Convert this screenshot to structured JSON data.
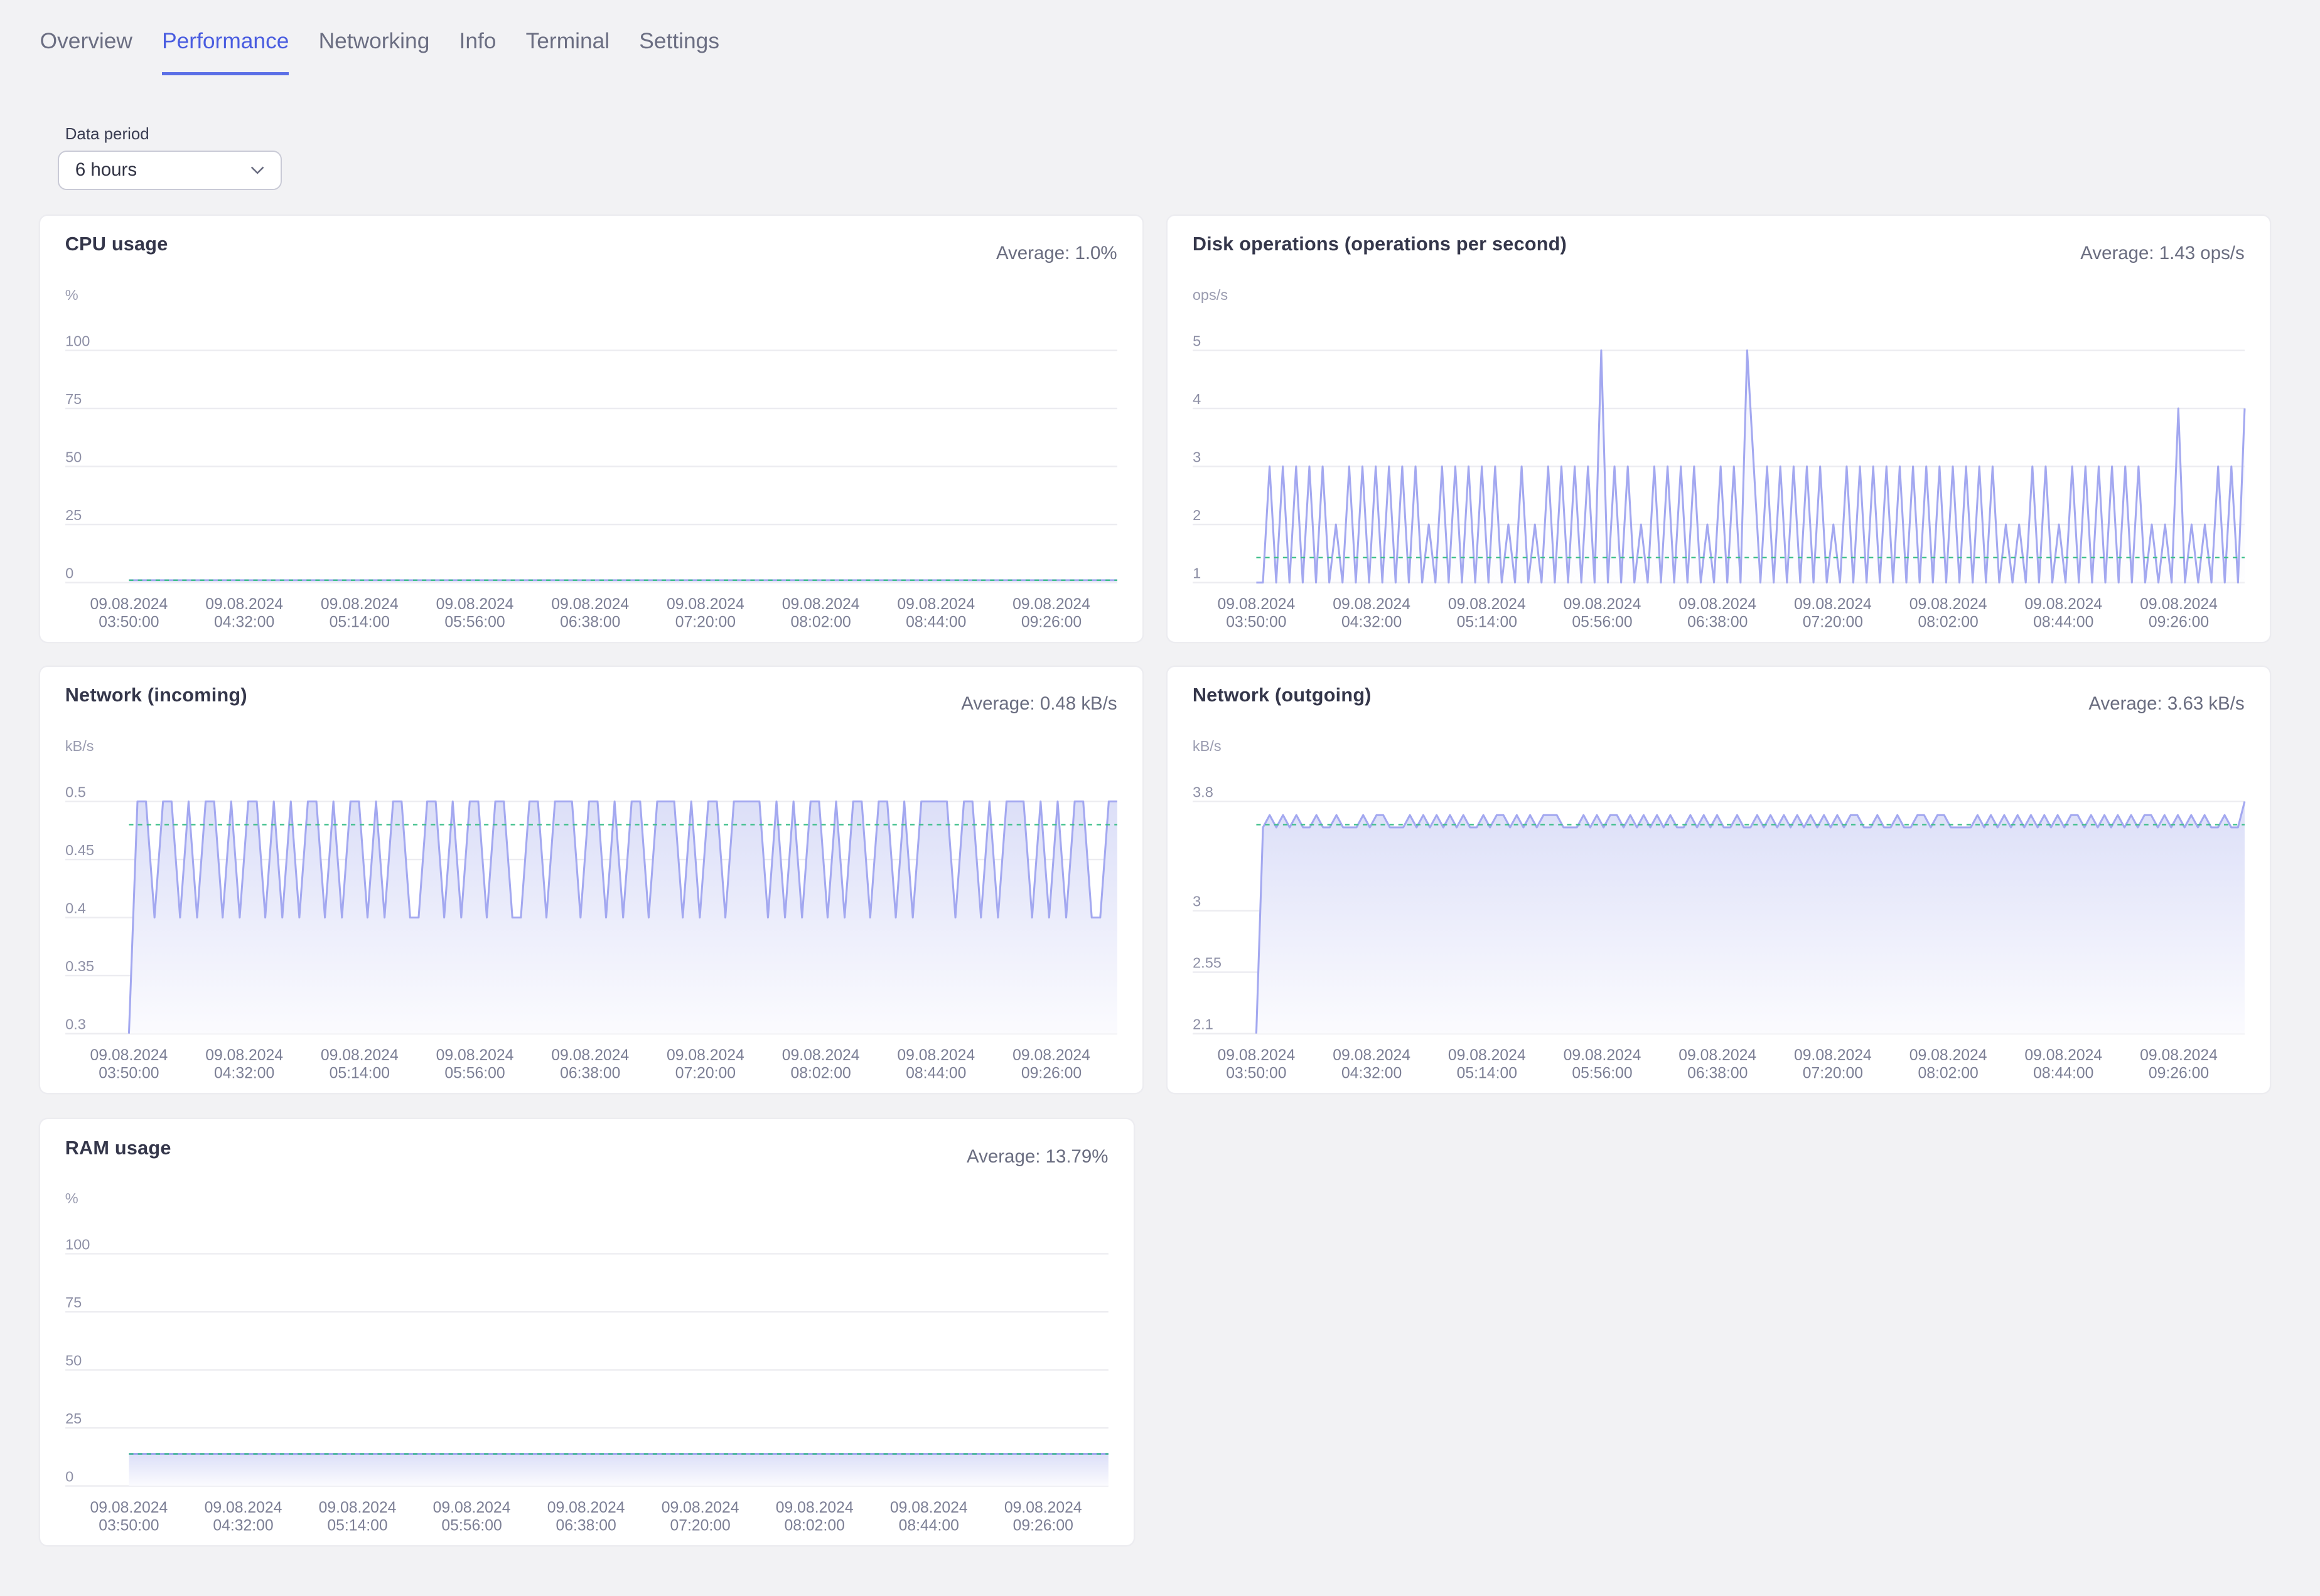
{
  "tabs": [
    {
      "label": "Overview",
      "active": false
    },
    {
      "label": "Performance",
      "active": true
    },
    {
      "label": "Networking",
      "active": false
    },
    {
      "label": "Info",
      "active": false
    },
    {
      "label": "Terminal",
      "active": false
    },
    {
      "label": "Settings",
      "active": false
    }
  ],
  "period": {
    "label": "Data period",
    "value": "6 hours",
    "icon": "chevron-down-icon"
  },
  "colors": {
    "accent": "#5b6fe6",
    "line": "#a3a8f0",
    "average": "#3dbf8a",
    "grid": "#ececf0"
  },
  "x_tick_labels": [
    [
      "09.08.2024",
      "03:50:00"
    ],
    [
      "09.08.2024",
      "04:32:00"
    ],
    [
      "09.08.2024",
      "05:14:00"
    ],
    [
      "09.08.2024",
      "05:56:00"
    ],
    [
      "09.08.2024",
      "06:38:00"
    ],
    [
      "09.08.2024",
      "07:20:00"
    ],
    [
      "09.08.2024",
      "08:02:00"
    ],
    [
      "09.08.2024",
      "08:44:00"
    ],
    [
      "09.08.2024",
      "09:26:00"
    ]
  ],
  "chart_data": [
    {
      "id": "cpu",
      "type": "line",
      "title": "CPU usage",
      "average_label": "Average: 1.0%",
      "average": 1.0,
      "ylabel": "%",
      "ylim": [
        0,
        100
      ],
      "yticks": [
        100,
        75,
        50,
        25,
        0
      ],
      "ytick_labels": [
        "100",
        "75",
        "50",
        "25",
        "0"
      ],
      "xrange": [
        "09.08.2024 03:50:00",
        "09.08.2024 09:50:00"
      ],
      "values": [
        1,
        1,
        1,
        1,
        1,
        1,
        1,
        1,
        1,
        1,
        1,
        1,
        1,
        1,
        1,
        1,
        1,
        1,
        1,
        1
      ]
    },
    {
      "id": "disk",
      "type": "line",
      "title": "Disk operations (operations per second)",
      "average_label": "Average: 1.43 ops/s",
      "average": 1.43,
      "ylabel": "ops/s",
      "ylim": [
        1,
        5
      ],
      "yticks": [
        5,
        4,
        3,
        2,
        1
      ],
      "ytick_labels": [
        "5",
        "4",
        "3",
        "2",
        "1"
      ],
      "xrange": [
        "09.08.2024 03:50:00",
        "09.08.2024 09:50:00"
      ],
      "values": [
        1,
        1,
        3,
        1,
        3,
        1,
        3,
        1,
        3,
        1,
        3,
        1,
        2,
        1,
        3,
        1,
        3,
        1,
        3,
        1,
        3,
        1,
        3,
        1,
        3,
        1,
        2,
        1,
        3,
        1,
        3,
        1,
        3,
        1,
        3,
        1,
        3,
        1,
        2,
        1,
        3,
        1,
        2,
        1,
        3,
        1,
        3,
        1,
        3,
        1,
        3,
        1,
        5,
        1,
        3,
        1,
        3,
        1,
        2,
        1,
        3,
        1,
        3,
        1,
        3,
        1,
        3,
        1,
        2,
        1,
        3,
        1,
        3,
        1,
        5,
        3,
        1,
        3,
        1,
        3,
        1,
        3,
        1,
        3,
        1,
        3,
        1,
        2,
        1,
        3,
        1,
        3,
        1,
        3,
        1,
        3,
        1,
        3,
        1,
        3,
        1,
        3,
        1,
        3,
        1,
        3,
        1,
        3,
        1,
        3,
        1,
        3,
        1,
        2,
        1,
        2,
        1,
        3,
        1,
        3,
        1,
        2,
        1,
        3,
        1,
        3,
        1,
        3,
        1,
        3,
        1,
        3,
        1,
        3,
        1,
        2,
        1,
        2,
        1,
        4,
        1,
        2,
        1,
        2,
        1,
        3,
        1,
        3,
        1,
        4
      ]
    },
    {
      "id": "net-in",
      "type": "area",
      "title": "Network (incoming)",
      "average_label": "Average: 0.48 kB/s",
      "average": 0.48,
      "ylabel": "kB/s",
      "ylim": [
        0.3,
        0.5
      ],
      "yticks": [
        0.5,
        0.45,
        0.4,
        0.35,
        0.3
      ],
      "ytick_labels": [
        "0.5",
        "0.45",
        "0.4",
        "0.35",
        "0.3"
      ],
      "xrange": [
        "09.08.2024 03:50:00",
        "09.08.2024 09:50:00"
      ],
      "values": [
        0.3,
        0.5,
        0.5,
        0.4,
        0.5,
        0.5,
        0.4,
        0.5,
        0.4,
        0.5,
        0.5,
        0.4,
        0.5,
        0.4,
        0.5,
        0.5,
        0.4,
        0.5,
        0.4,
        0.5,
        0.4,
        0.5,
        0.5,
        0.4,
        0.5,
        0.4,
        0.5,
        0.5,
        0.4,
        0.5,
        0.4,
        0.5,
        0.5,
        0.4,
        0.4,
        0.5,
        0.5,
        0.4,
        0.5,
        0.4,
        0.5,
        0.5,
        0.4,
        0.5,
        0.5,
        0.4,
        0.4,
        0.5,
        0.5,
        0.4,
        0.5,
        0.5,
        0.5,
        0.4,
        0.5,
        0.5,
        0.4,
        0.5,
        0.4,
        0.5,
        0.5,
        0.4,
        0.5,
        0.5,
        0.5,
        0.4,
        0.5,
        0.4,
        0.5,
        0.5,
        0.4,
        0.5,
        0.5,
        0.5,
        0.5,
        0.4,
        0.5,
        0.4,
        0.5,
        0.4,
        0.5,
        0.5,
        0.4,
        0.5,
        0.4,
        0.5,
        0.5,
        0.4,
        0.5,
        0.5,
        0.4,
        0.5,
        0.4,
        0.5,
        0.5,
        0.5,
        0.5,
        0.4,
        0.5,
        0.5,
        0.4,
        0.5,
        0.4,
        0.5,
        0.5,
        0.5,
        0.4,
        0.5,
        0.4,
        0.5,
        0.4,
        0.5,
        0.5,
        0.4,
        0.4,
        0.5,
        0.5
      ]
    },
    {
      "id": "net-out",
      "type": "area",
      "title": "Network (outgoing)",
      "average_label": "Average: 3.63 kB/s",
      "average": 3.63,
      "ylabel": "kB/s",
      "ylim": [
        2.1,
        3.8
      ],
      "yticks": [
        3.8,
        3,
        2.55,
        2.1
      ],
      "ytick_labels": [
        "3.8",
        "3",
        "2.55",
        "2.1"
      ],
      "xrange": [
        "09.08.2024 03:50:00",
        "09.08.2024 09:50:00"
      ],
      "values": [
        2.1,
        3.61,
        3.7,
        3.61,
        3.7,
        3.61,
        3.7,
        3.61,
        3.61,
        3.7,
        3.61,
        3.61,
        3.7,
        3.61,
        3.61,
        3.61,
        3.7,
        3.61,
        3.7,
        3.7,
        3.61,
        3.61,
        3.61,
        3.7,
        3.61,
        3.7,
        3.61,
        3.7,
        3.61,
        3.7,
        3.61,
        3.7,
        3.61,
        3.61,
        3.7,
        3.61,
        3.7,
        3.7,
        3.61,
        3.7,
        3.61,
        3.7,
        3.61,
        3.7,
        3.7,
        3.7,
        3.61,
        3.61,
        3.61,
        3.7,
        3.61,
        3.7,
        3.61,
        3.7,
        3.7,
        3.61,
        3.7,
        3.61,
        3.7,
        3.61,
        3.7,
        3.61,
        3.7,
        3.61,
        3.61,
        3.7,
        3.61,
        3.7,
        3.61,
        3.7,
        3.61,
        3.61,
        3.7,
        3.61,
        3.61,
        3.7,
        3.61,
        3.7,
        3.61,
        3.7,
        3.61,
        3.7,
        3.61,
        3.7,
        3.61,
        3.7,
        3.61,
        3.7,
        3.61,
        3.7,
        3.7,
        3.61,
        3.61,
        3.7,
        3.61,
        3.61,
        3.7,
        3.61,
        3.61,
        3.7,
        3.7,
        3.61,
        3.7,
        3.7,
        3.61,
        3.61,
        3.61,
        3.61,
        3.7,
        3.61,
        3.7,
        3.61,
        3.7,
        3.61,
        3.7,
        3.61,
        3.7,
        3.61,
        3.7,
        3.61,
        3.7,
        3.61,
        3.7,
        3.7,
        3.61,
        3.7,
        3.61,
        3.7,
        3.61,
        3.7,
        3.61,
        3.7,
        3.61,
        3.7,
        3.7,
        3.61,
        3.7,
        3.61,
        3.7,
        3.61,
        3.7,
        3.61,
        3.7,
        3.61,
        3.61,
        3.7,
        3.61,
        3.61,
        3.8
      ]
    },
    {
      "id": "ram",
      "type": "area",
      "title": "RAM usage",
      "average_label": "Average: 13.79%",
      "average": 13.79,
      "ylabel": "%",
      "ylim": [
        0,
        100
      ],
      "yticks": [
        100,
        75,
        50,
        25,
        0
      ],
      "ytick_labels": [
        "100",
        "75",
        "50",
        "25",
        "0"
      ],
      "xrange": [
        "09.08.2024 03:50:00",
        "09.08.2024 09:50:00"
      ],
      "values": [
        13.8,
        13.8,
        13.79,
        13.78,
        13.79,
        13.8,
        13.79,
        13.79,
        13.78,
        13.79,
        13.8,
        13.79,
        13.79,
        13.8,
        13.79,
        13.78,
        13.79,
        13.79,
        13.8,
        13.79
      ]
    }
  ]
}
